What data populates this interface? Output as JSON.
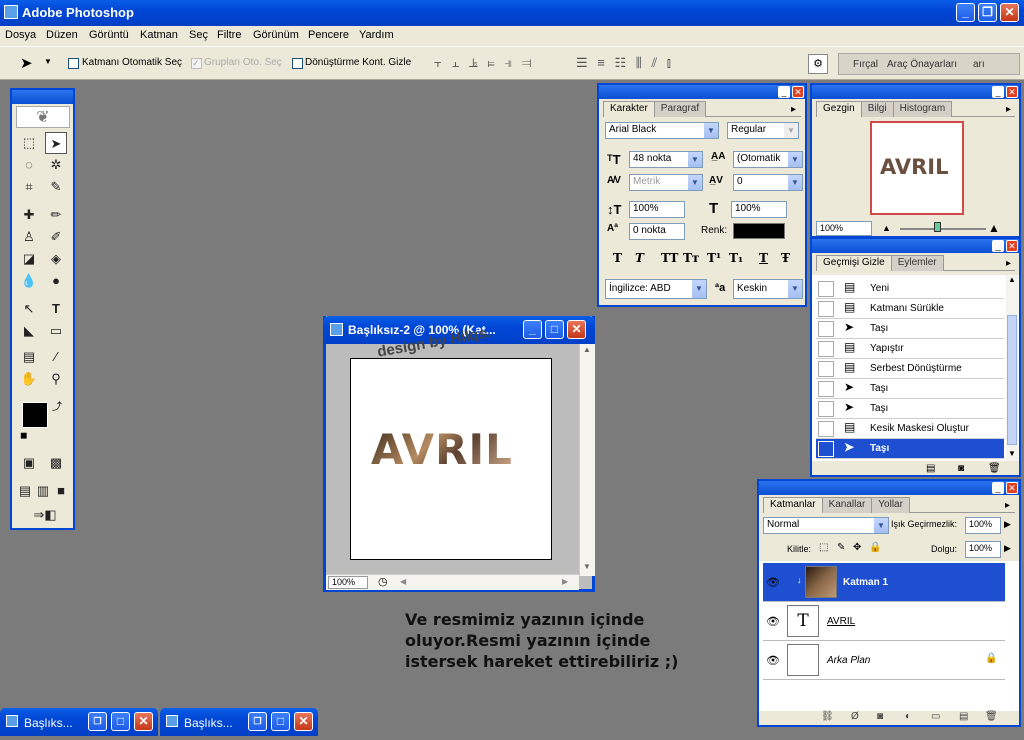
{
  "app": {
    "title": "Adobe Photoshop"
  },
  "menu": [
    "Dosya",
    "Düzen",
    "Görüntü",
    "Katman",
    "Seç",
    "Filtre",
    "Görünüm",
    "Pencere",
    "Yardım"
  ],
  "options": {
    "auto_select": "Katmanı Otomatik Seç",
    "group_select": "Grupları Oto. Seç",
    "transform": "Dönüştürme Kont. Gizle",
    "well_tab1": "Fırçal",
    "well_tab2": "Araç Önayarları",
    "well_tab3": "arı"
  },
  "doc": {
    "title": "Başlıksız-2 @ 100% (Kat...",
    "watermark": "design by Hilqs.",
    "text": "AVRIL",
    "zoom": "100%"
  },
  "caption": {
    "line1": "Ve resmimiz yazının içinde",
    "line2": "oluyor.Resmi yazının içinde",
    "line3": "istersek hareket ettirebiliriz ;)"
  },
  "character": {
    "tab1": "Karakter",
    "tab2": "Paragraf",
    "font": "Arial Black",
    "style": "Regular",
    "size": "48 nokta",
    "leading": "(Otomatik",
    "kerning": "Metrik",
    "tracking": "0",
    "vscale": "100%",
    "hscale": "100%",
    "baseline": "0 nokta",
    "color_label": "Renk:",
    "color": "#000000",
    "language": "İngilizce: ABD",
    "aa_label": "ªa",
    "aa": "Keskin",
    "styles": [
      "T",
      "T",
      "TT",
      "Tт",
      "T¹",
      "T₁",
      "T",
      "Ŧ"
    ]
  },
  "navigator": {
    "tab1": "Gezgin",
    "tab2": "Bilgi",
    "tab3": "Histogram",
    "zoom": "100%",
    "preview": "AVRIL"
  },
  "history": {
    "tab1": "Geçmişi Gizle",
    "tab2": "Eylemler",
    "items": [
      {
        "icon": "doc-icon",
        "label": "Yeni"
      },
      {
        "icon": "doc-icon",
        "label": "Katmanı Sürükle"
      },
      {
        "icon": "move-icon",
        "label": "Taşı"
      },
      {
        "icon": "doc-icon",
        "label": "Yapıştır"
      },
      {
        "icon": "doc-icon",
        "label": "Serbest Dönüştürme"
      },
      {
        "icon": "move-icon",
        "label": "Taşı"
      },
      {
        "icon": "move-icon",
        "label": "Taşı"
      },
      {
        "icon": "doc-icon",
        "label": "Kesik Maskesi Oluştur"
      },
      {
        "icon": "move-icon",
        "label": "Taşı"
      }
    ]
  },
  "layers": {
    "tab1": "Katmanlar",
    "tab2": "Kanallar",
    "tab3": "Yollar",
    "blend": "Normal",
    "opacity_label": "Işık Geçirmezlik:",
    "opacity": "100%",
    "lock_label": "Kilitle:",
    "fill_label": "Dolgu:",
    "fill": "100%",
    "items": [
      {
        "name": "Katman 1",
        "selected": true
      },
      {
        "name": "AVRIL",
        "thumb": "T"
      },
      {
        "name": "Arka Plan"
      }
    ]
  },
  "taskbar": [
    {
      "label": "Başlıks..."
    },
    {
      "label": "Başlıks..."
    }
  ]
}
